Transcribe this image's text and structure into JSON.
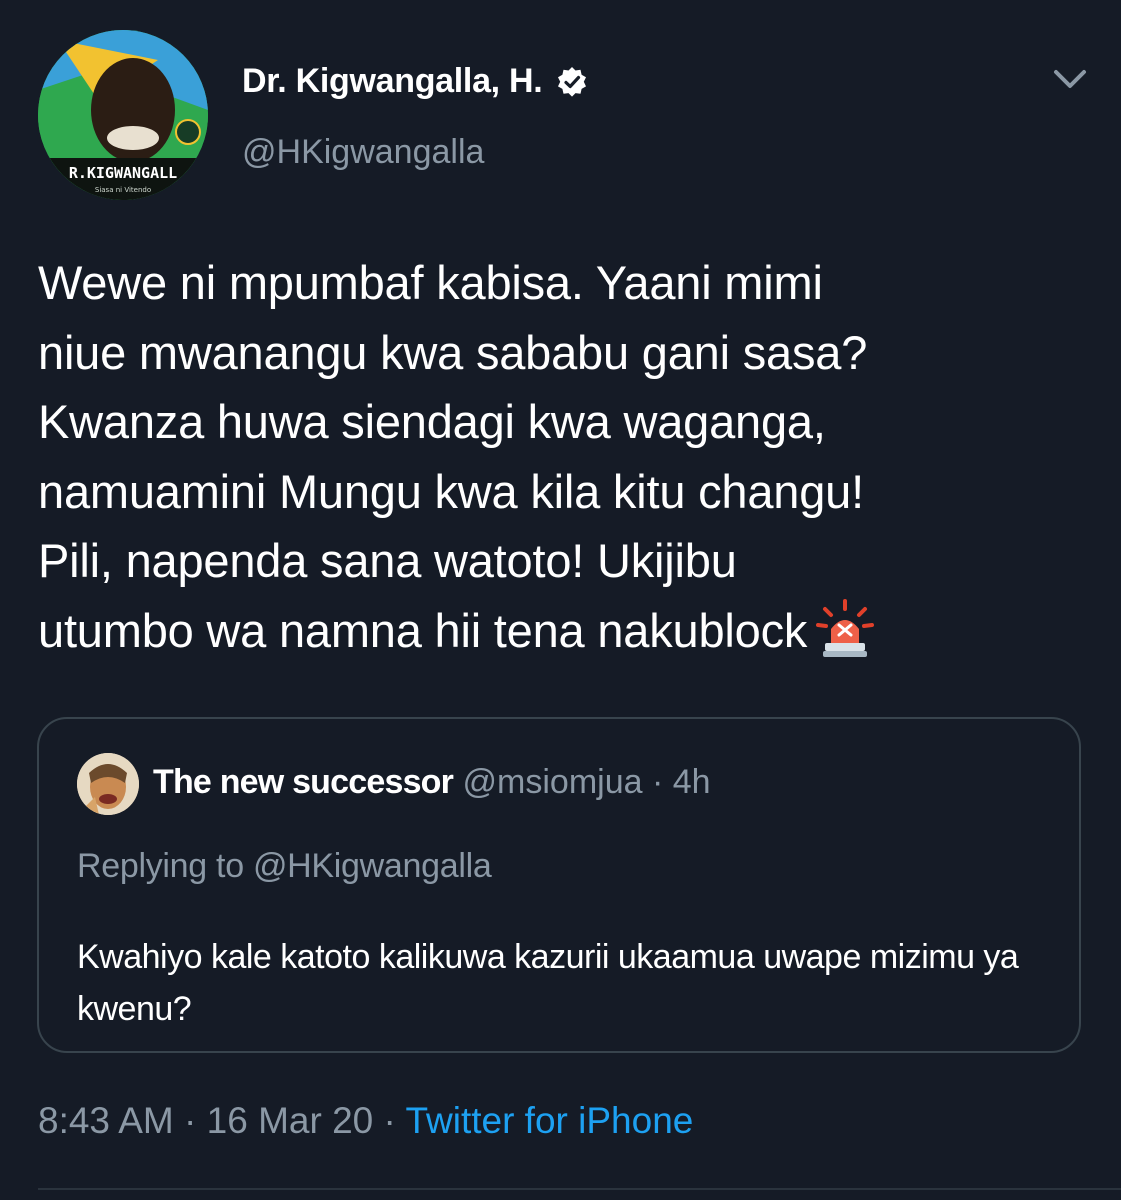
{
  "tweet": {
    "author": {
      "display_name": "Dr. Kigwangalla, H.",
      "handle": "@HKigwangalla",
      "avatar_banner_text": "R.KIGWANGALL",
      "avatar_banner_subtext": "Siasa ni Vitendo",
      "verified": true
    },
    "text_lines": [
      "Wewe ni mpumbaf kabisa. Yaani mimi",
      "niue mwanangu kwa sababu gani sasa?",
      "Kwanza huwa siendagi kwa waganga,",
      "namuamini Mungu kwa kila kitu changu!",
      "Pili, napenda sana watoto! Ukijibu",
      "utumbo wa namna hii tena nakublock"
    ],
    "emoji": "police-siren-icon",
    "timestamp": "8:43 AM · 16 Mar 20 · ",
    "source": "Twitter for iPhone"
  },
  "quoted_tweet": {
    "display_name": "The new successor",
    "meta": " @msiomjua · 4h",
    "replying_to": "Replying to @HKigwangalla",
    "text": "Kwahiyo kale katoto kalikuwa kazurii ukaamua uwape mizimu ya kwenu?"
  },
  "colors": {
    "background": "#151b26",
    "text_primary": "#ffffff",
    "text_secondary": "#8b98a5",
    "link": "#1da1f2",
    "border": "#38444d"
  }
}
